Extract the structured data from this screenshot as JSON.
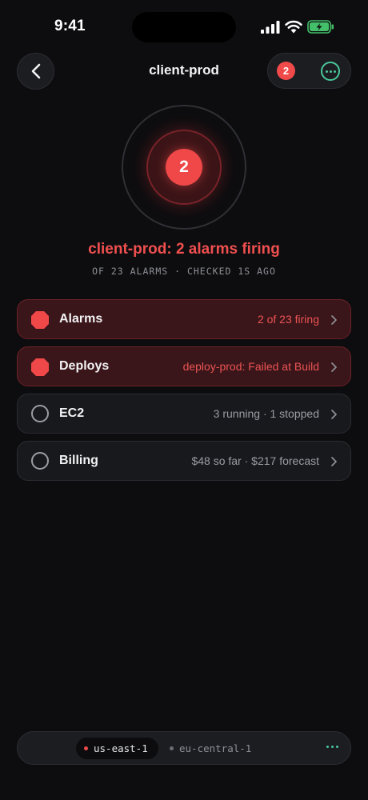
{
  "status_bar": {
    "time": "9:41"
  },
  "nav": {
    "title": "client-prod",
    "badge_count": "2",
    "back_icon": "chevron-left-icon",
    "more_icon": "ellipsis-circle-icon"
  },
  "hero": {
    "count": "2",
    "title": "client-prod: 2 alarms firing",
    "subtitle": "OF 23 ALARMS · CHECKED 1S AGO"
  },
  "rows": [
    {
      "label": "Alarms",
      "value": "2 of 23 firing",
      "state": "alert",
      "icon": "octagon-alert-icon"
    },
    {
      "label": "Deploys",
      "value": "deploy-prod: Failed at Build",
      "state": "alert",
      "icon": "octagon-alert-icon"
    },
    {
      "label": "EC2",
      "value": "3 running · 1 stopped",
      "state": "ok",
      "icon": "circle-icon"
    },
    {
      "label": "Billing",
      "value": "$48 so far · $217 forecast",
      "state": "ok",
      "icon": "circle-icon"
    }
  ],
  "regions": [
    {
      "name": "us-east-1",
      "active": true,
      "status_color": "#ef4a4a"
    },
    {
      "name": "eu-central-1",
      "active": false,
      "status_color": "#6c6e74"
    }
  ],
  "colors": {
    "accent_red": "#f04848",
    "accent_green": "#49c79a",
    "background": "#0d0d0f"
  }
}
